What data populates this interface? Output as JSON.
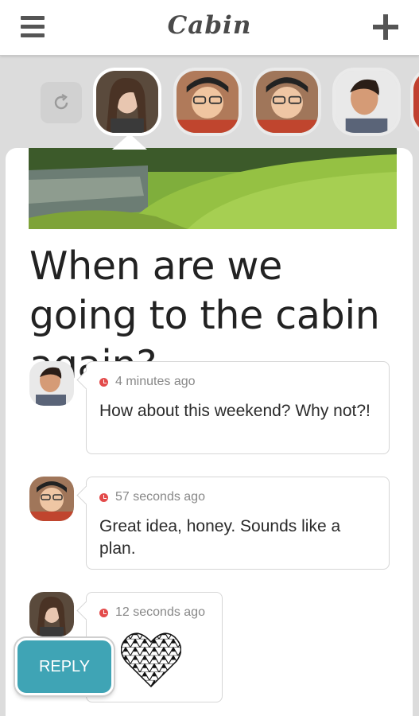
{
  "app": {
    "title": "Cabin"
  },
  "topbar": {
    "menu_icon": "hamburger-menu-icon",
    "add_icon": "plus-icon"
  },
  "people": [
    {
      "name": "",
      "active": true
    },
    {
      "name": "",
      "active": false
    },
    {
      "name": "",
      "active": false
    },
    {
      "name": "",
      "active": false
    }
  ],
  "post": {
    "title": "When are we going to the cabin again?"
  },
  "comments": [
    {
      "time": "4 minutes ago",
      "text": "How about this weekend? Why not?!"
    },
    {
      "time": "57 seconds ago",
      "text": "Great idea, honey. Sounds like a plan."
    },
    {
      "time": "12 seconds ago",
      "text": "",
      "sticker": "heart-icon"
    }
  ],
  "actions": {
    "reply_label": "REPLY"
  },
  "colors": {
    "accent": "#3fa4b5",
    "clock": "#e34b4b"
  }
}
